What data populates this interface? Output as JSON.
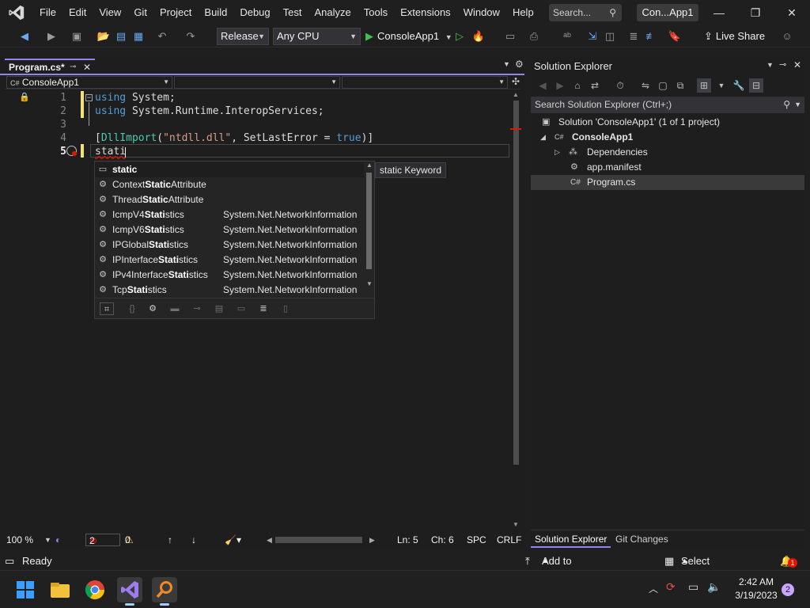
{
  "menu": {
    "items": [
      "File",
      "Edit",
      "View",
      "Git",
      "Project",
      "Build",
      "Debug",
      "Test",
      "Analyze",
      "Tools",
      "Extensions",
      "Window",
      "Help"
    ],
    "search_placeholder": "Search...",
    "solution_name": "Con...App1",
    "window_buttons": [
      "—",
      "❐",
      "✕"
    ]
  },
  "toolbar": {
    "configuration": "Release",
    "platform": "Any CPU",
    "start_target": "ConsoleApp1",
    "live_share": "Live Share"
  },
  "editor": {
    "tab_label": "Program.cs*",
    "nav_project": "ConsoleApp1",
    "line_numbers": [
      "1",
      "2",
      "3",
      "4",
      "5"
    ],
    "lines": [
      [
        {
          "t": "using",
          "c": "kw"
        },
        {
          "t": " System;",
          "c": ""
        }
      ],
      [
        {
          "t": "using",
          "c": "kw"
        },
        {
          "t": " System.Runtime.InteropServices;",
          "c": ""
        }
      ],
      [],
      [
        {
          "t": "[",
          "c": ""
        },
        {
          "t": "DllImport",
          "c": "attr"
        },
        {
          "t": "(",
          "c": ""
        },
        {
          "t": "\"ntdll.dll\"",
          "c": "str"
        },
        {
          "t": ", SetLastError = ",
          "c": ""
        },
        {
          "t": "true",
          "c": "kw"
        },
        {
          "t": ")]",
          "c": ""
        }
      ],
      [
        {
          "t": "stati",
          "c": ""
        }
      ]
    ]
  },
  "completion": {
    "items": [
      {
        "icon": "keyword-icon",
        "pre": "",
        "match": "static",
        "post": "",
        "ns": ""
      },
      {
        "icon": "class-icon",
        "pre": "Context",
        "match": "Static",
        "post": "Attribute",
        "ns": ""
      },
      {
        "icon": "class-icon",
        "pre": "Thread",
        "match": "Static",
        "post": "Attribute",
        "ns": ""
      },
      {
        "icon": "class-icon",
        "pre": "IcmpV4",
        "match": "Stati",
        "post": "stics",
        "ns": "System.Net.NetworkInformation"
      },
      {
        "icon": "class-icon",
        "pre": "IcmpV6",
        "match": "Stati",
        "post": "stics",
        "ns": "System.Net.NetworkInformation"
      },
      {
        "icon": "class-icon",
        "pre": "IPGlobal",
        "match": "Stati",
        "post": "stics",
        "ns": "System.Net.NetworkInformation"
      },
      {
        "icon": "class-icon",
        "pre": "IPInterface",
        "match": "Stati",
        "post": "stics",
        "ns": "System.Net.NetworkInformation"
      },
      {
        "icon": "class-icon",
        "pre": "IPv4Interface",
        "match": "Stati",
        "post": "stics",
        "ns": "System.Net.NetworkInformation"
      },
      {
        "icon": "class-icon",
        "pre": "Tcp",
        "match": "Stati",
        "post": "stics",
        "ns": "System.Net.NetworkInformation"
      }
    ],
    "tooltip": "static Keyword"
  },
  "editor_status": {
    "zoom": "100 %",
    "errors": "2",
    "warnings": "0",
    "line": "Ln: 5",
    "col": "Ch: 6",
    "indent": "SPC",
    "line_endings": "CRLF"
  },
  "solution_explorer": {
    "title": "Solution Explorer",
    "search_placeholder": "Search Solution Explorer (Ctrl+;)",
    "solution": "Solution 'ConsoleApp1' (1 of 1 project)",
    "project": "ConsoleApp1",
    "dependencies": "Dependencies",
    "manifest": "app.manifest",
    "program": "Program.cs",
    "tabs": [
      "Solution Explorer",
      "Git Changes"
    ]
  },
  "statusbar": {
    "ready": "Ready",
    "add_source_control": "Add to Source Control",
    "select_repository": "Select Repository",
    "notifications": "1"
  },
  "taskbar": {
    "time": "2:42 AM",
    "date": "3/19/2023",
    "badge": "2"
  },
  "colors": {
    "accent": "#9184ee",
    "keyword": "#569cd6",
    "type": "#4ec9b0",
    "string": "#d69d85",
    "error": "#e51400"
  }
}
